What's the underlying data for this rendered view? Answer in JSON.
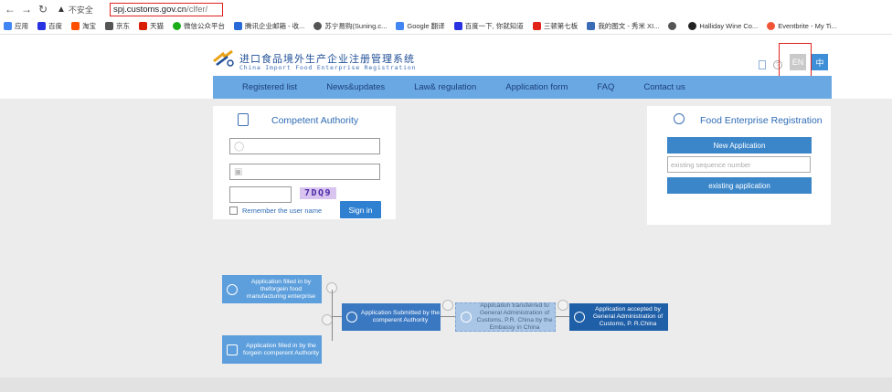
{
  "browser": {
    "insecure_label": "不安全",
    "url_host": "spj.customs.gov.cn",
    "url_path": "/clfer/",
    "bookmarks": [
      {
        "label": "应用",
        "color": "#4285f4"
      },
      {
        "label": "百度",
        "color": "#2932e1"
      },
      {
        "label": "淘宝",
        "color": "#ff5000"
      },
      {
        "label": "京东",
        "color": "#555555"
      },
      {
        "label": "天猫",
        "color": "#d81e06"
      },
      {
        "label": "微信公众平台",
        "color": "#1aad19"
      },
      {
        "label": "腾讯企业邮箱 - 收...",
        "color": "#2a6ad8"
      },
      {
        "label": "苏宁易购(Suning.c...",
        "color": "#555555"
      },
      {
        "label": "Google 翻译",
        "color": "#4285f4"
      },
      {
        "label": "百度一下, 你就知道",
        "color": "#2932e1"
      },
      {
        "label": "三顿第七板",
        "color": "#e2231a"
      },
      {
        "label": "我的图文 - 秀米 XI...",
        "color": "#3a6db5"
      },
      {
        "label": "",
        "color": "#555555"
      },
      {
        "label": "Halliday Wine Co...",
        "color": "#222222"
      },
      {
        "label": "Eventbrite - My Ti...",
        "color": "#f05537"
      }
    ]
  },
  "header": {
    "logo_cn": "进口食品境外生产企业注册管理系统",
    "logo_en": "China Import Food Enterprise Registration",
    "lang_en": "EN",
    "lang_zh": "中"
  },
  "nav": {
    "items": [
      "Registered list",
      "News&updates",
      "Law& regulation",
      "Application form",
      "FAQ",
      "Contact us"
    ]
  },
  "login": {
    "title": "Competent Authority",
    "captcha": "7DQ9",
    "remember_label": "Remember the user name",
    "signin_label": "Sign in"
  },
  "registration": {
    "title": "Food Enterprise Registration",
    "new_application_label": "New Application",
    "sequence_placeholder": "existing sequence number",
    "existing_application_label": "existing application"
  },
  "flow": {
    "step1": "Application filled in by theforgein food manufacturing enterprise",
    "step1b": "Application filled in by the forgein comperent Authority",
    "step2": "Application Submitted by the comperent Authority",
    "step3": "Application transferred to General Administration of Customs, P.R. China by the Embassy in China",
    "step4": "Application accepted by General Administration of Customs, P. R.China"
  },
  "colors": {
    "nav_bg": "#6aa8e3",
    "primary_blue": "#3b86c9",
    "highlight_red": "#e0221f"
  }
}
